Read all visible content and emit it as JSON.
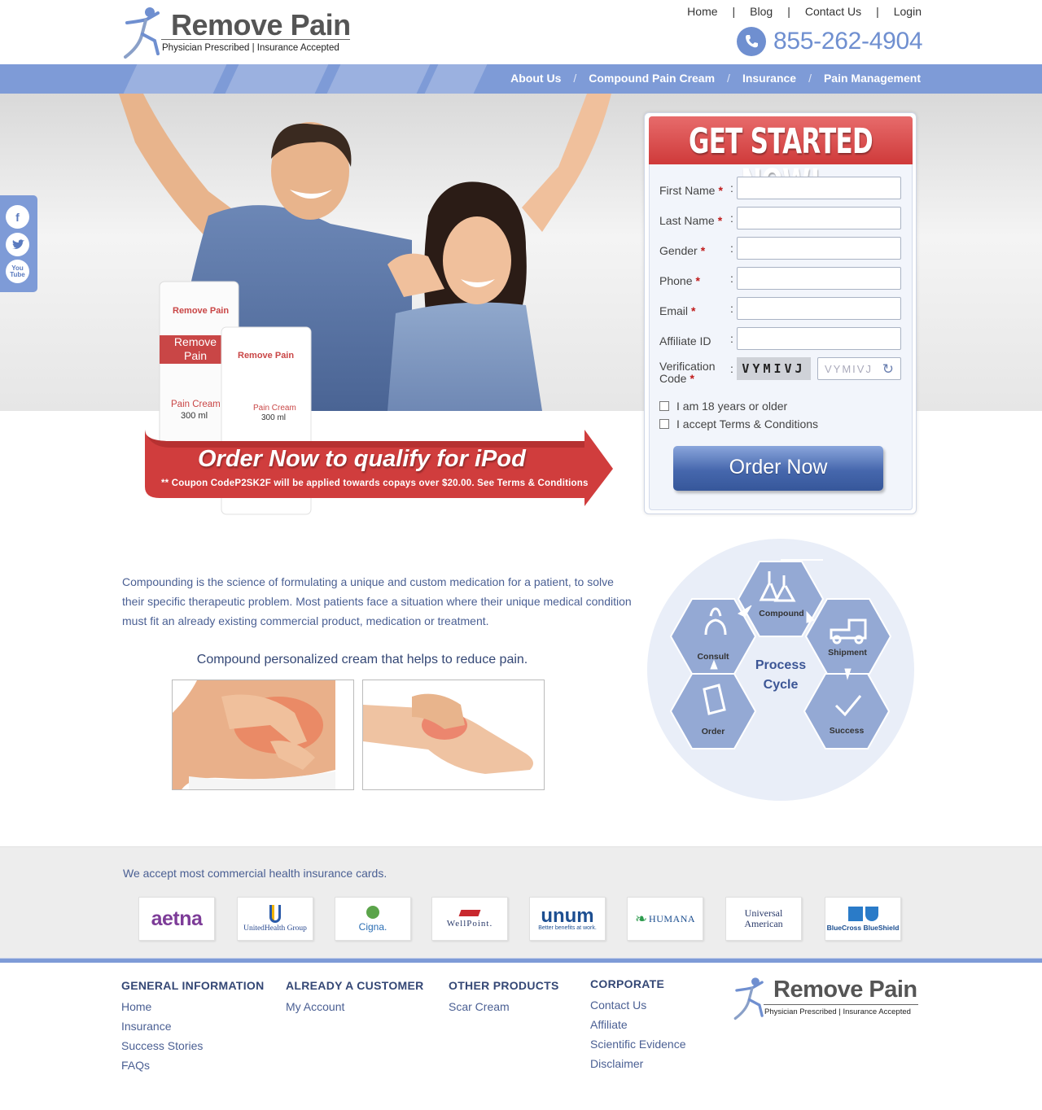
{
  "brand": {
    "name": "Remove Pain",
    "tagline": "Physician Prescribed | Insurance Accepted"
  },
  "top_nav": [
    "Home",
    "Blog",
    "Contact Us",
    "Login"
  ],
  "phone": "855-262-4904",
  "main_nav": [
    "About Us",
    "Compound Pain Cream",
    "Insurance",
    "Pain Management"
  ],
  "social": [
    "facebook-icon",
    "twitter-icon",
    "youtube-icon"
  ],
  "product": {
    "brand": "Remove Pain",
    "band": "Remove Pain",
    "label": "Pain Cream",
    "size": "300 ml"
  },
  "promo": {
    "headline": "Order Now to qualify for iPod",
    "note": "** Coupon CodeP2SK2F  will be applied towards copays over $20.00. See Terms & Conditions"
  },
  "form": {
    "title": "GET STARTED NOW!",
    "fields": [
      {
        "label": "First Name",
        "required": true
      },
      {
        "label": "Last Name",
        "required": true
      },
      {
        "label": "Gender",
        "required": true
      },
      {
        "label": "Phone",
        "required": true
      },
      {
        "label": "Email",
        "required": true
      },
      {
        "label": "Affiliate ID",
        "required": false
      }
    ],
    "verification_label_1": "Verification",
    "verification_label_2": "Code",
    "captcha_text": "VYMIVJ",
    "captcha_placeholder": "VYMIVJ",
    "checkbox_age": "I am 18 years or older",
    "checkbox_terms": "I accept Terms & Conditions",
    "submit": "Order Now",
    "required_mark": "*",
    "colon": ":"
  },
  "intro": "Compounding is the science of formulating a unique and custom medication for a patient, to solve their specific therapeutic problem. Most patients face a situation where their unique medical condition must fit an already existing commercial product, medication or treatment.",
  "subhead": "Compound personalized cream that helps to reduce pain.",
  "cycle": {
    "title_1": "Process",
    "title_2": "Cycle",
    "steps": [
      "Compound",
      "Consult",
      "Shipment",
      "Order",
      "Success"
    ]
  },
  "insurance": {
    "text": "We accept most commercial health insurance cards.",
    "cards": [
      "aetna",
      "UnitedHealth Group",
      "Cigna.",
      "WellPoint.",
      "unum",
      "HUMANA",
      "Universal American",
      "BlueCross BlueShield"
    ],
    "unum_tagline": "Better benefits at work."
  },
  "footer": {
    "general": {
      "title": "GENERAL INFORMATION",
      "links": [
        "Home",
        "Insurance",
        "Success Stories",
        "FAQs"
      ]
    },
    "customer": {
      "title": "ALREADY A CUSTOMER",
      "links": [
        "My Account"
      ]
    },
    "products": {
      "title": "OTHER PRODUCTS",
      "links": [
        "Scar Cream"
      ]
    },
    "corporate": {
      "title": "CORPORATE",
      "links": [
        "Contact Us",
        "Affiliate",
        "Scientific Evidence",
        "Disclaimer"
      ]
    }
  },
  "colors": {
    "accent": "#7e9bd7",
    "brand_blue": "#4a5f93",
    "promo_red": "#d03d3d"
  }
}
